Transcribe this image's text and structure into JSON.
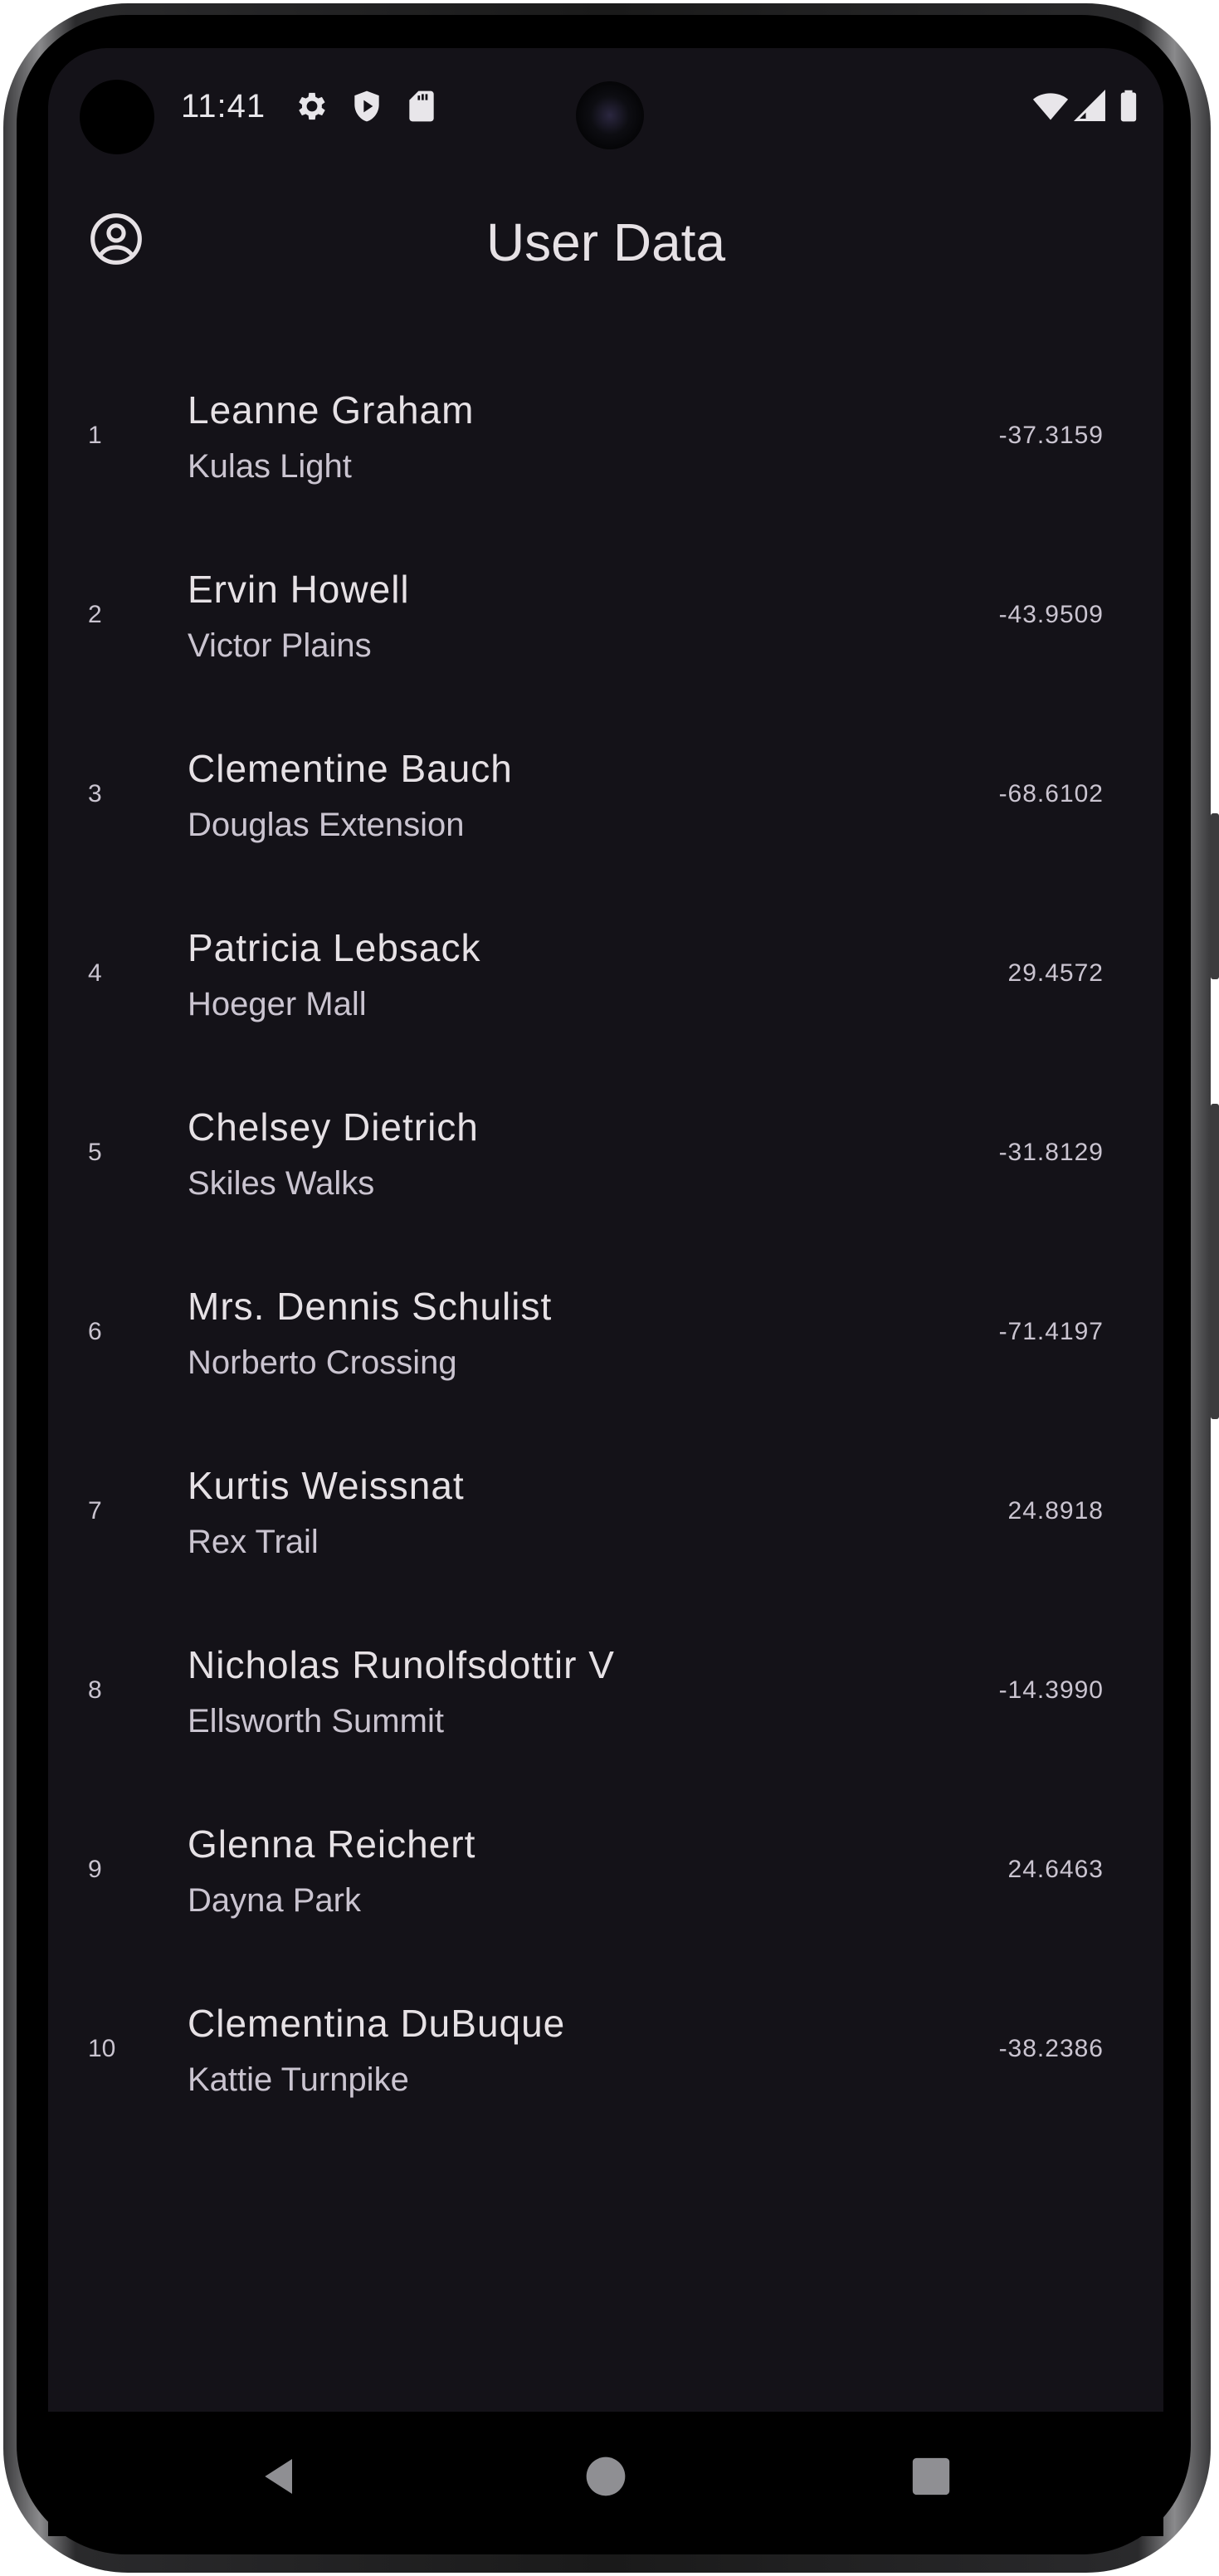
{
  "status_bar": {
    "time": "11:41",
    "icons_left": [
      "gear-icon",
      "shield-play-icon",
      "sd-card-icon"
    ],
    "icons_right": [
      "wifi-icon",
      "cellular-signal-icon",
      "battery-icon"
    ]
  },
  "app_bar": {
    "title": "User Data",
    "leading_icon": "account-circle-icon"
  },
  "users": [
    {
      "index": "1",
      "name": "Leanne Graham",
      "street": "Kulas Light",
      "value": "-37.3159"
    },
    {
      "index": "2",
      "name": "Ervin Howell",
      "street": "Victor Plains",
      "value": "-43.9509"
    },
    {
      "index": "3",
      "name": "Clementine Bauch",
      "street": "Douglas Extension",
      "value": "-68.6102"
    },
    {
      "index": "4",
      "name": "Patricia Lebsack",
      "street": "Hoeger Mall",
      "value": "29.4572"
    },
    {
      "index": "5",
      "name": "Chelsey Dietrich",
      "street": "Skiles Walks",
      "value": "-31.8129"
    },
    {
      "index": "6",
      "name": "Mrs. Dennis Schulist",
      "street": "Norberto Crossing",
      "value": "-71.4197"
    },
    {
      "index": "7",
      "name": "Kurtis Weissnat",
      "street": "Rex Trail",
      "value": "24.8918"
    },
    {
      "index": "8",
      "name": "Nicholas Runolfsdottir V",
      "street": "Ellsworth Summit",
      "value": "-14.3990"
    },
    {
      "index": "9",
      "name": "Glenna Reichert",
      "street": "Dayna Park",
      "value": "24.6463"
    },
    {
      "index": "10",
      "name": "Clementina DuBuque",
      "street": "Kattie Turnpike",
      "value": "-38.2386"
    }
  ],
  "nav_bar": {
    "buttons": [
      "back-icon",
      "home-icon",
      "recents-icon"
    ]
  },
  "colors": {
    "background": "#141218",
    "primary_text": "#e6e1e5",
    "secondary_text": "#cac4d0",
    "nav_bar": "#000000"
  }
}
